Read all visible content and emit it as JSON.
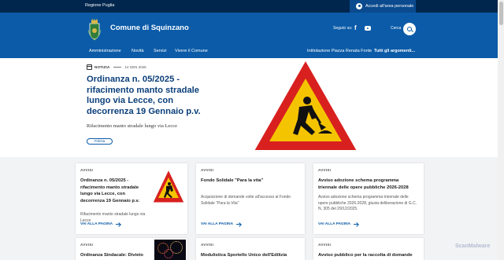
{
  "topbar": {
    "region": "Regione Puglia",
    "login_label": "Accedi all'area personale"
  },
  "header": {
    "site_name": "Comune di Squinzano",
    "follow_label": "Seguici su:",
    "search_label": "Cerca",
    "social": [
      "facebook-icon",
      "youtube-icon"
    ]
  },
  "nav": {
    "items": [
      "Amministrazione",
      "Novità",
      "Servizi",
      "Vivere il Comune"
    ],
    "right_items": [
      "Intitolazione Piazza Renata Fonte",
      "Tutti gli argomenti..."
    ]
  },
  "hero": {
    "category": "NOTIZIA",
    "date": "14 GEN 2026",
    "title": "Ordinanza n. 05/2025 - rifacimento manto stradale lungo via Lecce, con decorrenza 19 Gennaio p.v.",
    "subtitle": "Rifacimento manto stradale lungo via Lecce",
    "tag": "Polizia"
  },
  "cards": [
    {
      "kicker": "AVVISI",
      "title": "Ordinanza n. 05/2025 - rifacimento manto stradale lungo via Lecce, con decorrenza 19 Gennaio p.v.",
      "desc": "Rifacimento manto stradale lungo via Lecce",
      "more": "VAI ALLA PAGINA"
    },
    {
      "kicker": "AVVISI",
      "title": "Fondo Solidale \"Para la vita\"",
      "desc": "Acquisizione di domande volte all'accesso al Fondo Solidale \"Para la Vita\"",
      "more": "VAI ALLA PAGINA"
    },
    {
      "kicker": "AVVISI",
      "title": "Avviso adozione schema programma triennale delle opere pubbliche 2026-2028",
      "desc": "Avviso adozione schema programma triennale delle opere pubbliche 2026-2028, giusta deliberazione di G.C. N. 305 del 29/12/2025.",
      "more": "VAI ALLA PAGINA"
    },
    {
      "kicker": "AVVISI",
      "title": "Ordinanza Sindacale: Divieto di"
    },
    {
      "kicker": "AVVISI",
      "title": "Modulistica Sportello Unico dell'Edilizia"
    },
    {
      "kicker": "AVVISI",
      "title": "Avviso pubblico per la raccolta di domande per"
    }
  ],
  "watermark": "ScanMalware",
  "colors": {
    "dark_blue": "#00264d",
    "primary_blue": "#0b5ba8",
    "title_blue": "#0b3f7a",
    "warning_red": "#d8201f",
    "warning_yellow": "#f5c400"
  }
}
